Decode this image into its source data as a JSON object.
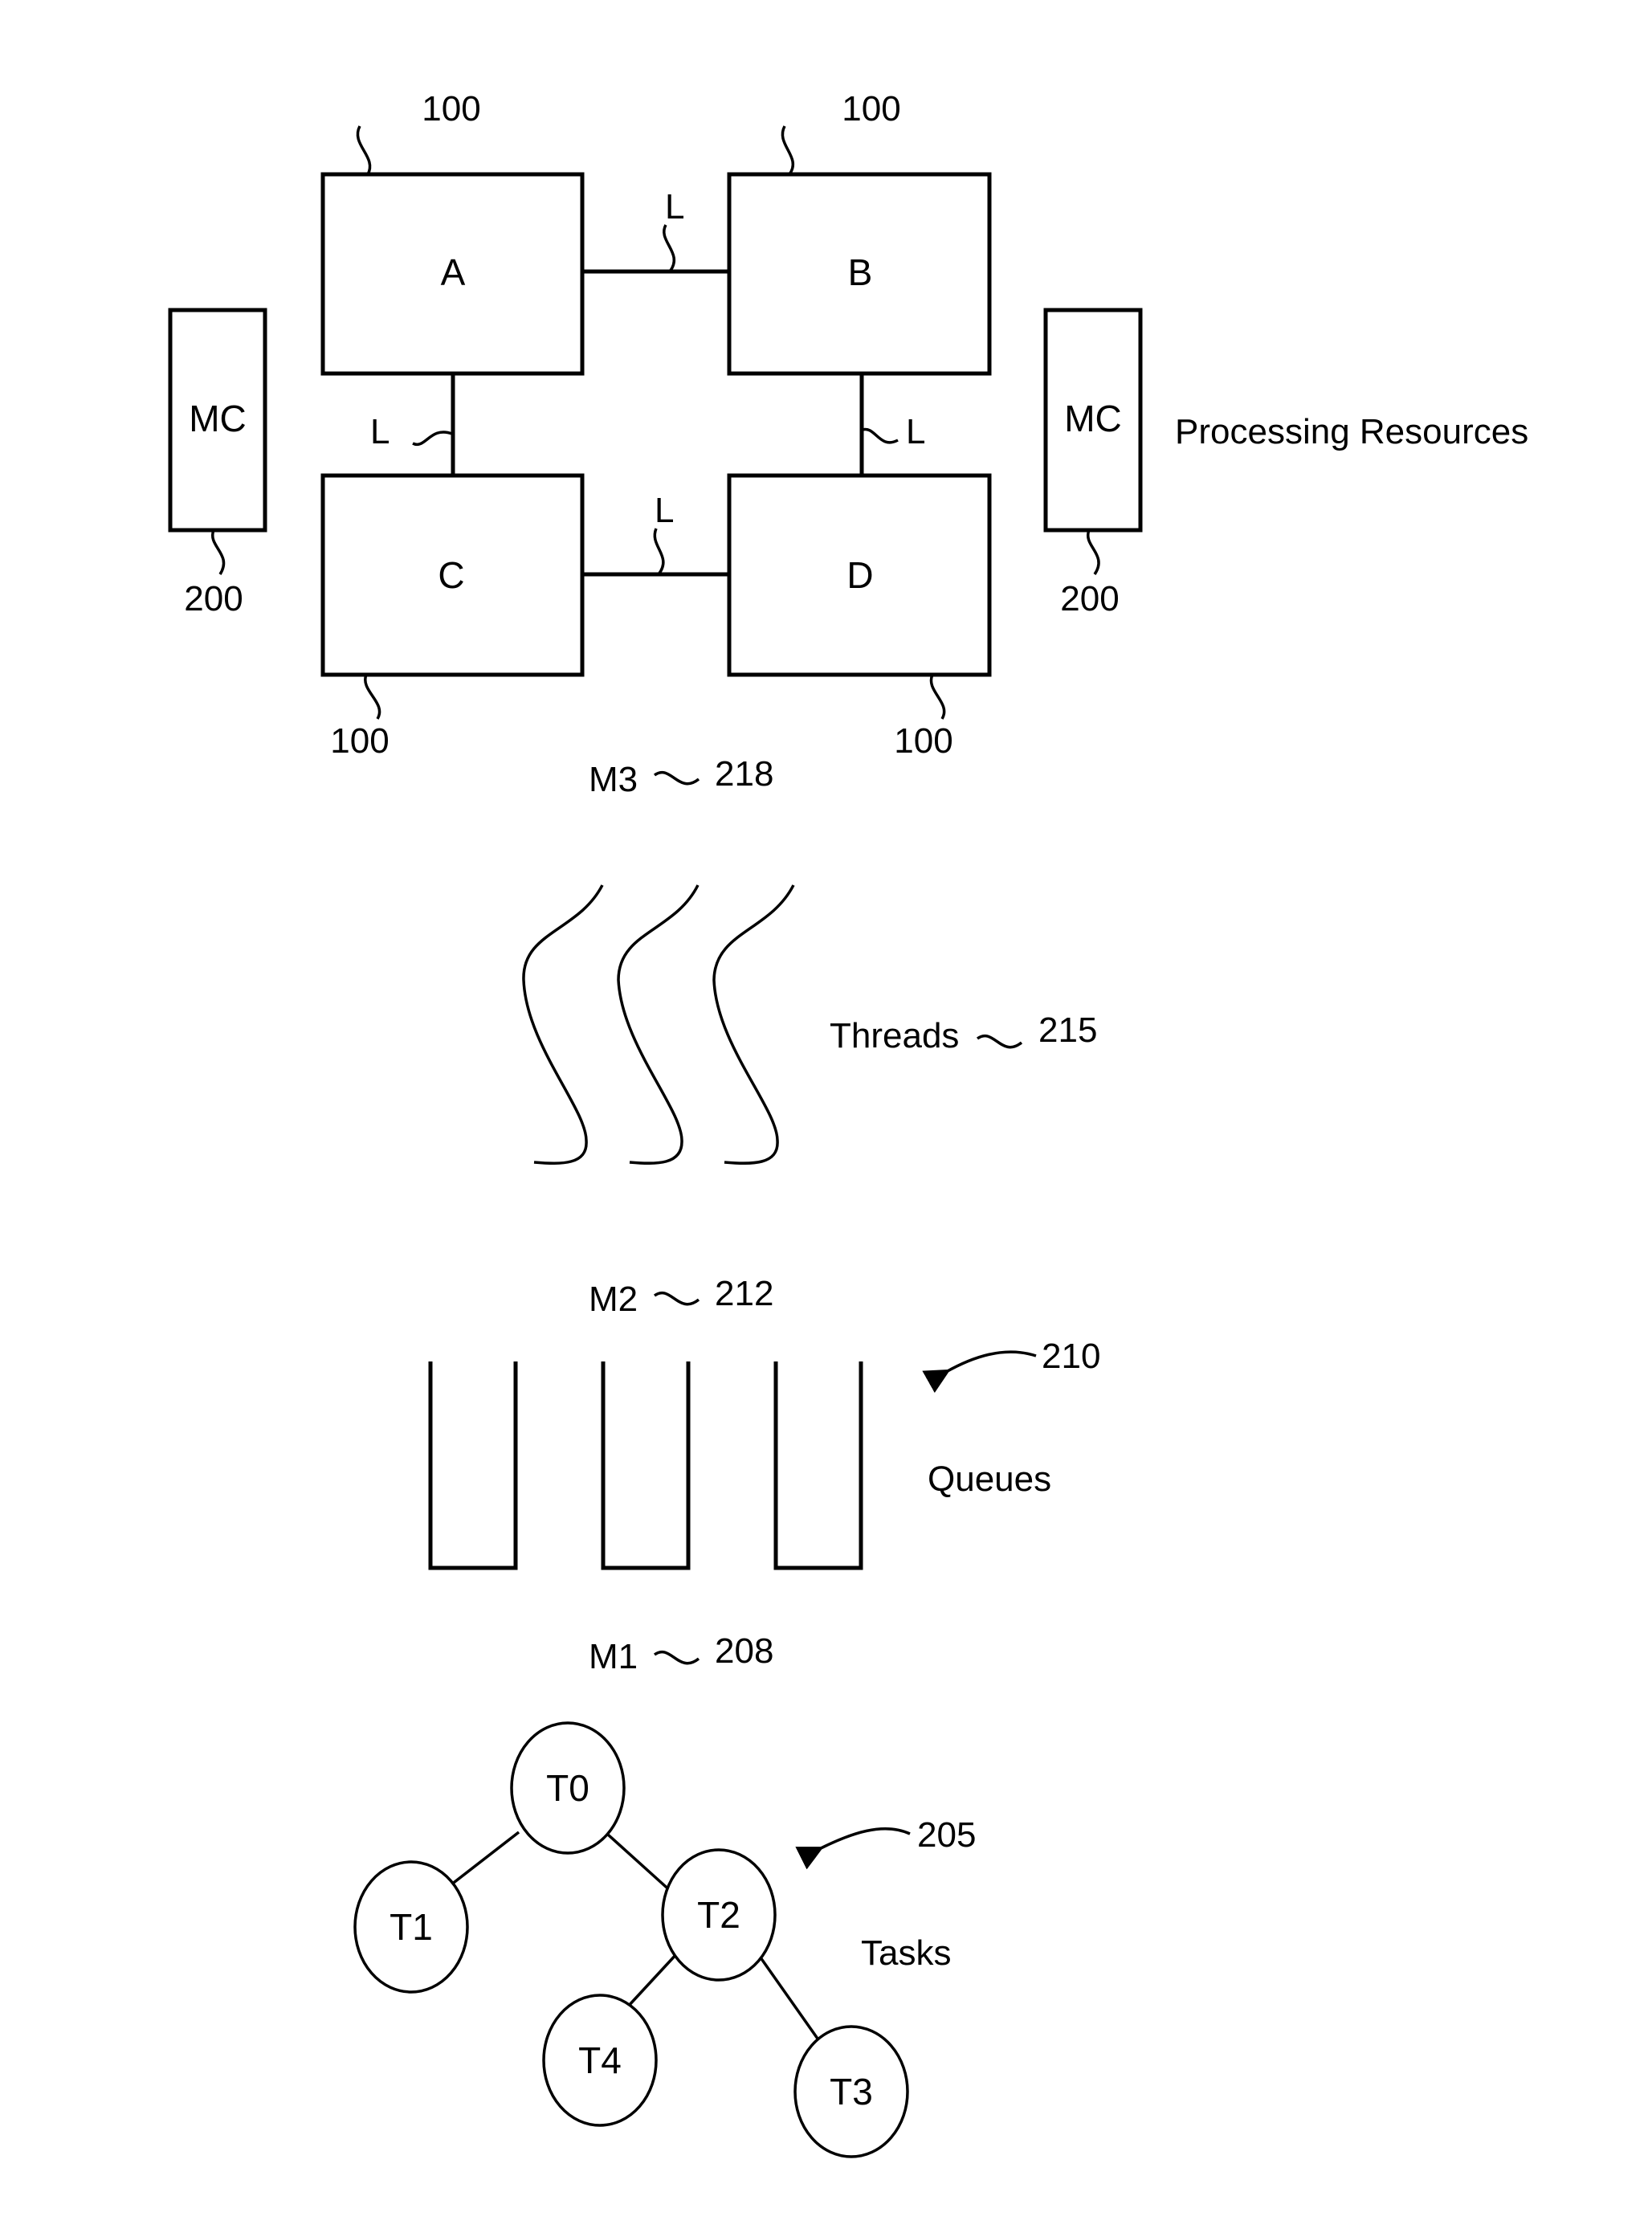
{
  "figure": {
    "processing_resources": {
      "label": "Processing Resources",
      "nodes": [
        {
          "id": "A",
          "label": "A",
          "ref": "100"
        },
        {
          "id": "B",
          "label": "B",
          "ref": "100"
        },
        {
          "id": "C",
          "label": "C",
          "ref": "100"
        },
        {
          "id": "D",
          "label": "D",
          "ref": "100"
        }
      ],
      "links": [
        {
          "from": "A",
          "to": "B",
          "label": "L"
        },
        {
          "from": "A",
          "to": "C",
          "label": "L"
        },
        {
          "from": "B",
          "to": "D",
          "label": "L"
        },
        {
          "from": "C",
          "to": "D",
          "label": "L"
        }
      ],
      "memory_controllers": [
        {
          "label": "MC",
          "ref": "200"
        },
        {
          "label": "MC",
          "ref": "200"
        }
      ]
    },
    "mapping_m3": {
      "label": "M3",
      "ref": "218"
    },
    "threads": {
      "label": "Threads",
      "ref": "215",
      "count": 3
    },
    "mapping_m2": {
      "label": "M2",
      "ref": "212"
    },
    "queues": {
      "label": "Queues",
      "ref": "210",
      "count": 3
    },
    "mapping_m1": {
      "label": "M1",
      "ref": "208"
    },
    "tasks": {
      "label": "Tasks",
      "ref": "205",
      "nodes": [
        {
          "id": "T0",
          "label": "T0"
        },
        {
          "id": "T1",
          "label": "T1"
        },
        {
          "id": "T2",
          "label": "T2"
        },
        {
          "id": "T3",
          "label": "T3"
        },
        {
          "id": "T4",
          "label": "T4"
        }
      ],
      "edges": [
        {
          "from": "T0",
          "to": "T1"
        },
        {
          "from": "T0",
          "to": "T2"
        },
        {
          "from": "T2",
          "to": "T4"
        },
        {
          "from": "T2",
          "to": "T3"
        }
      ]
    }
  }
}
